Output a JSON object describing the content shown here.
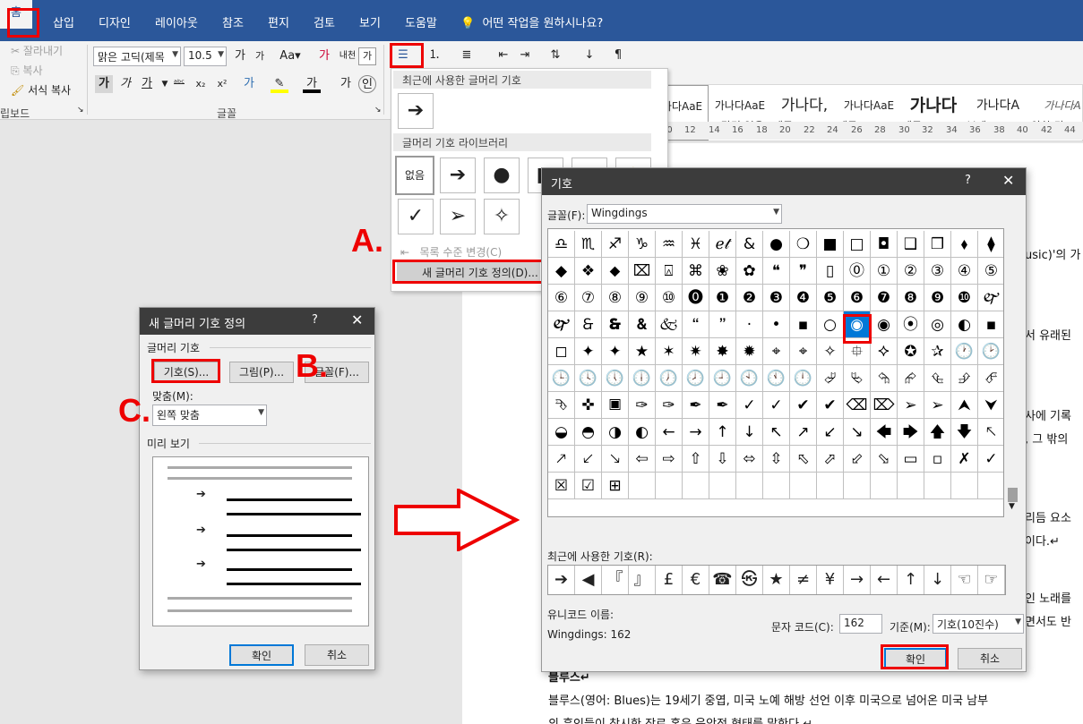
{
  "tabs": [
    "홈",
    "삽입",
    "디자인",
    "레이아웃",
    "참조",
    "편지",
    "검토",
    "보기",
    "도움말"
  ],
  "tellme": "어떤 작업을 원하시나요?",
  "clipboard": {
    "cut": "잘라내기",
    "copy": "복사",
    "format_painter": "서식 복사",
    "group": "립보드"
  },
  "font": {
    "name": "맑은 고딕(제목",
    "size": "10.5",
    "group": "글꼴"
  },
  "styles": [
    {
      "preview": "가나다AaE",
      "label": "표준"
    },
    {
      "preview": "가나다AaE",
      "label": "↲ 간격 없음"
    },
    {
      "preview": "가나다,",
      "label": "제목 1"
    },
    {
      "preview": "가나다AaE",
      "label": "제목 2"
    },
    {
      "preview": "가나다",
      "label": "제목"
    },
    {
      "preview": "가나다A",
      "label": "부제"
    },
    {
      "preview": "가나다A",
      "label": "약한 강조"
    }
  ],
  "ruler": [
    "10",
    "12",
    "14",
    "16",
    "18",
    "20",
    "22",
    "24",
    "26",
    "28",
    "30",
    "32",
    "34",
    "36",
    "38",
    "40",
    "42",
    "44"
  ],
  "dropdown": {
    "recent_header": "최근에 사용한 글머리 기호",
    "library_header": "글머리 기호 라이브러리",
    "none_label": "없음",
    "change_level": "목록 수준 변경(C)",
    "define_new": "새 글머리 기호 정의(D)..."
  },
  "labels": {
    "a": "A.",
    "b": "B.",
    "c": "C."
  },
  "new_bullet_dialog": {
    "title": "새 글머리 기호 정의",
    "help": "?",
    "close": "✕",
    "section_bullet": "글머리 기호",
    "symbol_button": "기호(S)...",
    "picture_button": "그림(P)...",
    "font_button": "글꼴(F)...",
    "align_label": "맞춤(M):",
    "align_value": "왼쪽 맞춤",
    "preview_label": "미리 보기",
    "ok": "확인",
    "cancel": "취소"
  },
  "symbol_dialog": {
    "title": "기호",
    "help": "?",
    "close": "✕",
    "font_label": "글꼴(F):",
    "font_value": "Wingdings",
    "recent_label": "최근에 사용한 기호(R):",
    "unicode_name_label": "유니코드 이름:",
    "unicode_name_value": "Wingdings: 162",
    "char_code_label": "문자 코드(C):",
    "char_code_value": "162",
    "from_label": "기준(M):",
    "from_value": "기호(10진수)",
    "ok": "확인",
    "cancel": "취소",
    "symbols": [
      [
        "♎",
        "♏",
        "♐",
        "♑",
        "♒",
        "♓",
        "ℯ𝓉",
        "&",
        "●",
        "❍",
        "■",
        "□",
        "◘",
        "❑",
        "❒",
        "⬧",
        "⧫"
      ],
      [
        "◆",
        "❖",
        "⬥",
        "⌧",
        "⍓",
        "⌘",
        "❀",
        "✿",
        "❝",
        "❞",
        "▯",
        "⓪",
        "①",
        "②",
        "③",
        "④",
        "⑤"
      ],
      [
        "⑥",
        "⑦",
        "⑧",
        "⑨",
        "⑩",
        "⓿",
        "❶",
        "❷",
        "❸",
        "❹",
        "❺",
        "❻",
        "❼",
        "❽",
        "❾",
        "❿",
        "🙰"
      ],
      [
        "🙱",
        "🙲",
        "🙳",
        "🙴",
        "🙵",
        "🙶",
        "🙷",
        "·",
        "•",
        "▪",
        "○",
        "◉",
        "◉",
        "⦿",
        "◎",
        "◐",
        "▪"
      ],
      [
        "◻",
        "✦",
        "✦",
        "★",
        "✶",
        "✷",
        "✸",
        "✹",
        "⌖",
        "⌖",
        "✧",
        "⯐",
        "⯎",
        "✪",
        "✰",
        "🕐",
        "🕑"
      ],
      [
        "🕒",
        "🕓",
        "🕔",
        "🕕",
        "🕖",
        "🕗",
        "🕘",
        "🕙",
        "🕚",
        "🕛",
        "⮰",
        "⮱",
        "⮲",
        "⮳",
        "⮴",
        "⮵",
        "⮶"
      ],
      [
        "⮷",
        "✜",
        "🞕",
        "✑",
        "✑",
        "✒",
        "✒",
        "✓",
        "✓",
        "✔",
        "✔",
        "⌫",
        "⌦",
        "➢",
        "➢",
        "⮝",
        "⮟"
      ],
      [
        "◒",
        "◓",
        "◑",
        "◐",
        "←",
        "→",
        "↑",
        "↓",
        "↖",
        "↗",
        "↙",
        "↘",
        "🡄",
        "🡆",
        "🡅",
        "🡇",
        "🡔"
      ],
      [
        "🡕",
        "🡗",
        "🡖",
        "⇦",
        "⇨",
        "⇧",
        "⇩",
        "⬄",
        "⇳",
        "⬁",
        "⬀",
        "⬃",
        "⬂",
        "▭",
        "▫",
        "✗",
        "✓"
      ],
      [
        "☒",
        "☑",
        "⊞",
        "",
        "",
        "",
        "",
        "",
        "",
        "",
        "",
        "",
        "",
        "",
        "",
        "",
        ""
      ]
    ],
    "recent_symbols": [
      "➔",
      "◀",
      "『",
      "』",
      "£",
      "€",
      "☎",
      "㉿",
      "★",
      "≠",
      "¥",
      "→",
      "←",
      "↑",
      "↓",
      "☜",
      "☞"
    ]
  },
  "document": [
    "usic)'의 가",
    "서 유래된",
    "사에 기록",
    ", 그 밖의",
    "리듬 요소",
    "이다.↵",
    "인 노래를",
    "면서도 반",
    "블루스↵",
    "블루스(영어: Blues)는 19세기 중엽, 미국 노예 해방 선언 이후 미국으로 넘어온 미국 남부",
    "의 흑인들이 창시한 장르 혹은 음악적 형태를 말한다.↵"
  ]
}
